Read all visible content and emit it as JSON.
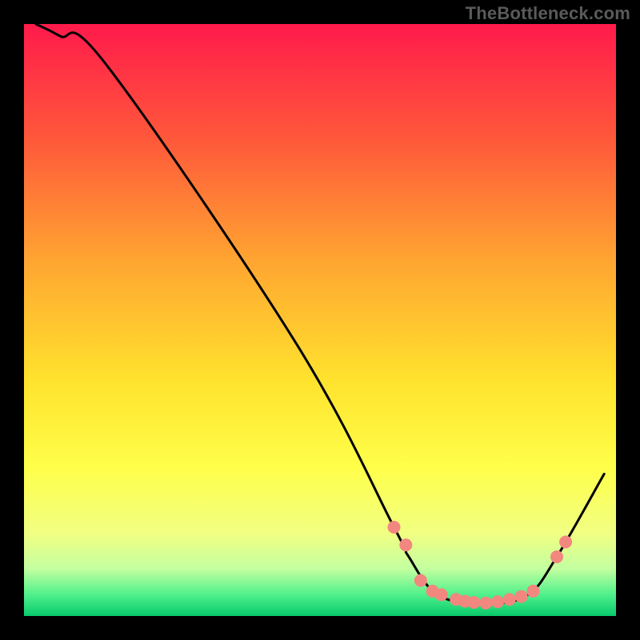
{
  "attribution": "TheBottleneck.com",
  "chart_data": {
    "type": "line",
    "title": "",
    "xlabel": "",
    "ylabel": "",
    "xlim": [
      0,
      100
    ],
    "ylim": [
      0,
      100
    ],
    "grid": false,
    "legend": false,
    "gradient_stops": [
      {
        "offset": 0.0,
        "color": "#ff1a4b"
      },
      {
        "offset": 0.2,
        "color": "#ff5a3a"
      },
      {
        "offset": 0.4,
        "color": "#ffa531"
      },
      {
        "offset": 0.6,
        "color": "#ffe22d"
      },
      {
        "offset": 0.75,
        "color": "#ffff4a"
      },
      {
        "offset": 0.86,
        "color": "#f1ff82"
      },
      {
        "offset": 0.92,
        "color": "#c4ffa0"
      },
      {
        "offset": 0.965,
        "color": "#4df08a"
      },
      {
        "offset": 1.0,
        "color": "#08c96b"
      }
    ],
    "series": [
      {
        "name": "bottleneck-curve",
        "type": "line",
        "x": [
          2,
          6,
          14,
          46,
          62.5,
          65,
          70,
          78,
          85,
          90,
          98
        ],
        "y": [
          100,
          98,
          93,
          46,
          15,
          10,
          3.5,
          2.2,
          3.5,
          10,
          24
        ]
      },
      {
        "name": "highlight-points",
        "type": "scatter",
        "x": [
          62.5,
          64.5,
          67,
          69,
          70.5,
          73,
          74.5,
          76,
          78,
          80,
          82,
          84,
          86,
          90,
          91.5
        ],
        "y": [
          15,
          12,
          6,
          4.2,
          3.6,
          2.8,
          2.5,
          2.3,
          2.2,
          2.4,
          2.8,
          3.3,
          4.2,
          10,
          12.5
        ]
      }
    ],
    "line_style": {
      "stroke": "#000000",
      "width": 3
    },
    "scatter_style": {
      "fill": "#f2877f",
      "radius": 8
    }
  }
}
